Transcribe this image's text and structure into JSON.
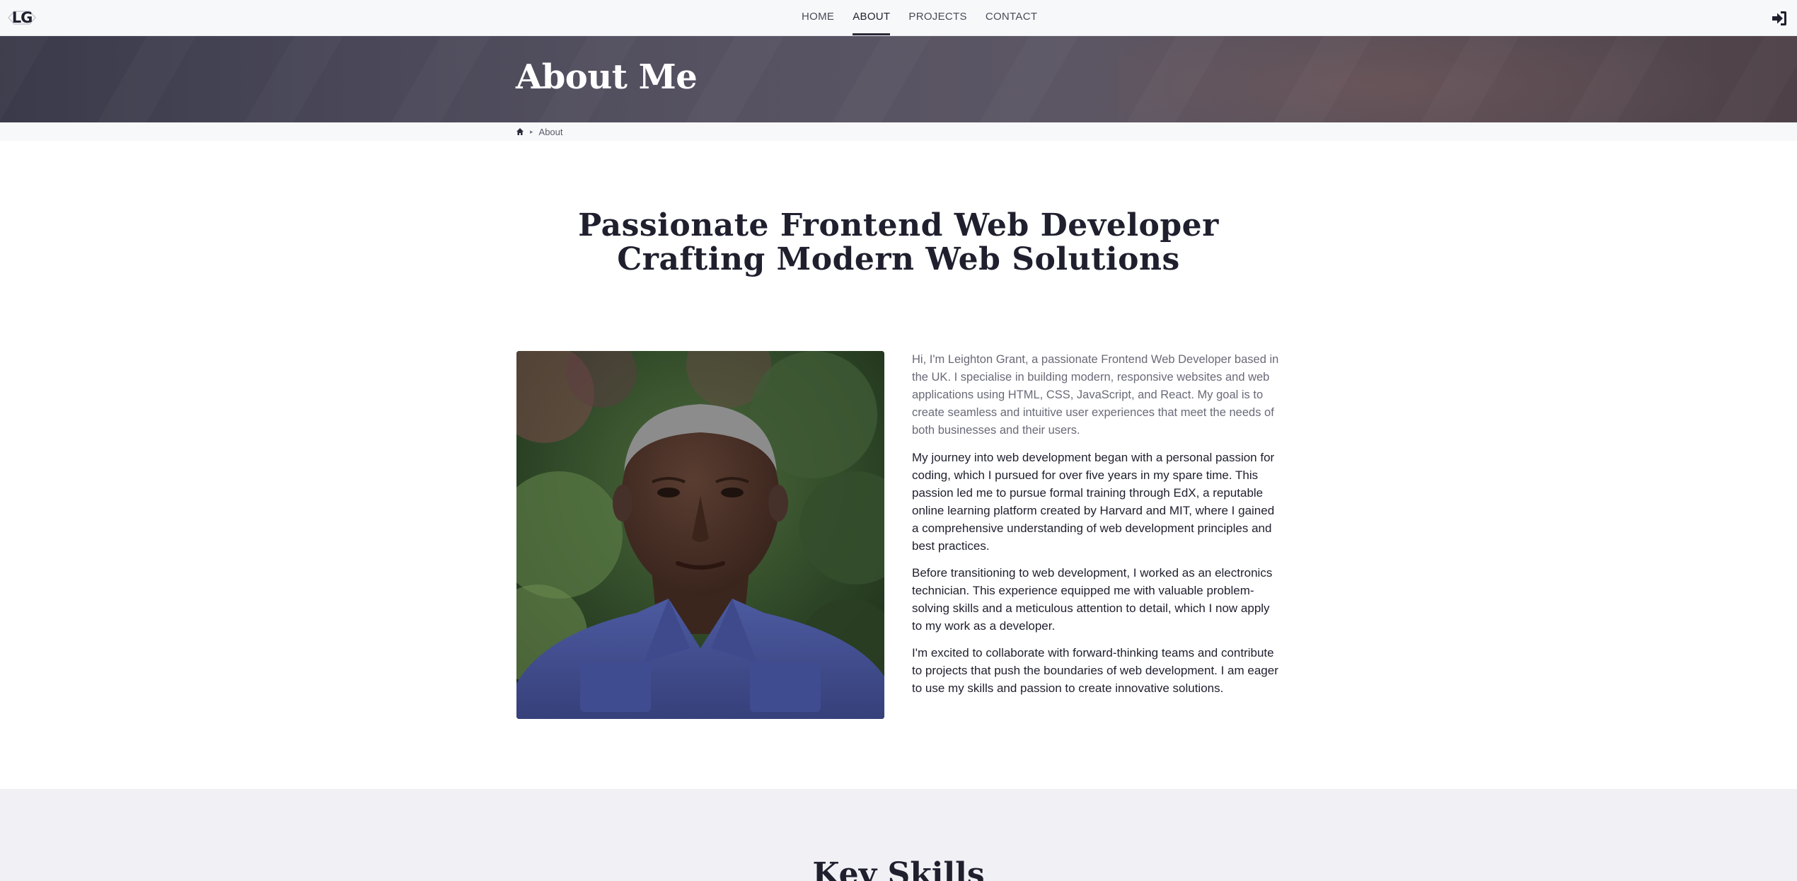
{
  "brand": {
    "logo_text": "LG"
  },
  "nav": {
    "items": [
      {
        "label": "HOME",
        "active": false
      },
      {
        "label": "ABOUT",
        "active": true
      },
      {
        "label": "PROJECTS",
        "active": false
      },
      {
        "label": "CONTACT",
        "active": false
      }
    ],
    "login_icon": "sign-in-icon"
  },
  "hero": {
    "title": "About Me"
  },
  "breadcrumb": {
    "home_icon": "home-icon",
    "separator": "▸",
    "current": "About"
  },
  "main": {
    "heading_line1": "Passionate Frontend Web Developer",
    "heading_line2": "Crafting Modern Web Solutions",
    "paragraphs": [
      "Hi, I'm Leighton Grant, a passionate Frontend Web Developer based in the UK. I specialise in building modern, responsive websites and web applications using HTML, CSS, JavaScript, and React. My goal is to create seamless and intuitive user experiences that meet the needs of both businesses and their users.",
      "My journey into web development began with a personal passion for coding, which I pursued for over five years in my spare time. This passion led me to pursue formal training through EdX, a reputable online learning platform created by Harvard and MIT, where I gained a comprehensive understanding of web development principles and best practices.",
      "Before transitioning to web development, I worked as an electronics technician. This experience equipped me with valuable problem-solving skills and a meticulous attention to detail, which I now apply to my work as a developer.",
      "I'm excited to collaborate with forward-thinking teams and contribute to projects that push the boundaries of web development. I am eager to use my skills and passion to create innovative solutions."
    ]
  },
  "skills": {
    "title": "Key Skills"
  },
  "colors": {
    "text": "#1f1f2e",
    "hero_bg": "#4a4858",
    "section_bg": "#f0f0f5",
    "nav_bg": "#f7f8fa"
  }
}
